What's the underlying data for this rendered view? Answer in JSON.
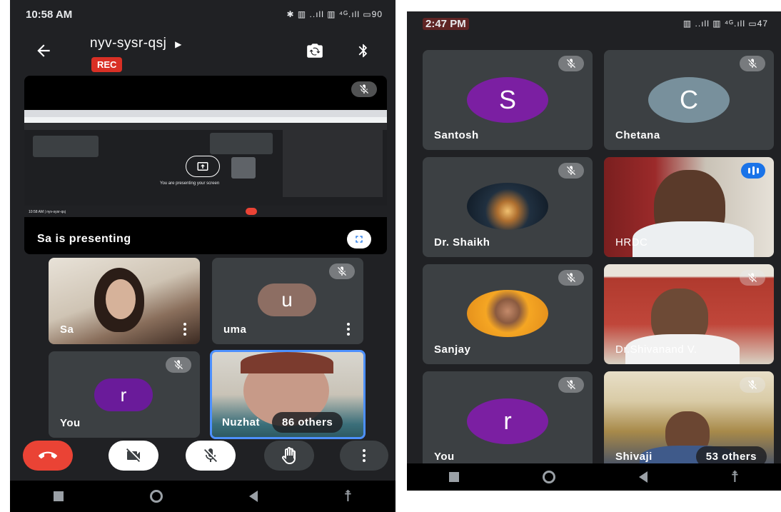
{
  "left": {
    "status": {
      "time": "10:58 AM",
      "icons": "✱ ▥ ..ıll ▥ ⁴ᴳ.ıll ▭90"
    },
    "header": {
      "meeting_code": "nyv-sysr-qsj",
      "rec_label": "REC"
    },
    "presentation": {
      "caption": "Sa is presenting",
      "inner_text": "You are presenting your screen",
      "inner_time": "10:58 AM | nyv-sysr-qsj"
    },
    "tiles": [
      {
        "name": "Sa",
        "type": "video"
      },
      {
        "name": "uma",
        "initial": "u",
        "avatar_color": "#8d6e63"
      },
      {
        "name": "You",
        "initial": "r",
        "avatar_color": "#6a1b9a"
      },
      {
        "name": "Nuzhat",
        "type": "video",
        "others": "86 others"
      }
    ],
    "controls": [
      "end-call",
      "camera-off",
      "mic-off",
      "raise-hand",
      "more"
    ]
  },
  "right": {
    "status": {
      "time": "2:47 PM",
      "icons": "▥ ..ıll ▥ ⁴ᴳ.ıll ▭47"
    },
    "tiles": [
      {
        "name": "Santosh",
        "initial": "S",
        "avatar_color": "#7b1fa2"
      },
      {
        "name": "Chetana",
        "initial": "C",
        "avatar_color": "#78909c"
      },
      {
        "name": "Dr. Shaikh",
        "type": "photo-avatar"
      },
      {
        "name": "HRDC",
        "type": "video"
      },
      {
        "name": "Sanjay",
        "type": "photo-avatar"
      },
      {
        "name": "Dr.Shivanand V.",
        "type": "video"
      },
      {
        "name": "You",
        "initial": "r",
        "avatar_color": "#7b1fa2"
      },
      {
        "name": "Shivaji",
        "type": "video",
        "others": "53 others"
      }
    ]
  }
}
